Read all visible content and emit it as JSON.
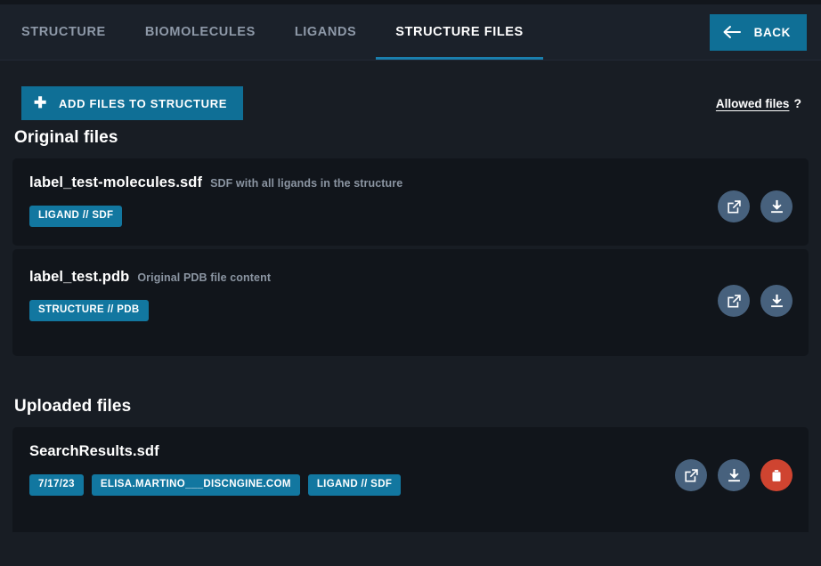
{
  "window": {
    "title": "Structure Files"
  },
  "colors": {
    "accent": "#0f6f96",
    "tag": "#1277a0",
    "tab_underline": "#1a7fad",
    "icon_button": "#47617d",
    "danger": "#cf4430",
    "page_background": "#181d24",
    "card_background": "#11151b",
    "tabbar_background": "#1b212a",
    "muted_text": "#8b95a2"
  },
  "tabbar": {
    "tabs": [
      {
        "label": "STRUCTURE",
        "active": false
      },
      {
        "label": "BIOMOLECULES",
        "active": false
      },
      {
        "label": "LIGANDS",
        "active": false
      },
      {
        "label": "STRUCTURE FILES",
        "active": true
      }
    ],
    "back_button": {
      "label": "BACK",
      "icon": "arrow-left-icon"
    }
  },
  "toolbar": {
    "add_files_label": "ADD FILES TO STRUCTURE",
    "add_files_icon": "plus-icon",
    "allowed_files_label": "Allowed files",
    "allowed_files_hint": "?"
  },
  "sections": [
    {
      "title": "Original files",
      "files": [
        {
          "name": "label_test-molecules.sdf",
          "description": "SDF with all ligands in the structure",
          "tags": [
            "LIGAND // SDF"
          ],
          "actions": [
            "external-link-icon",
            "download-icon"
          ]
        },
        {
          "name": "label_test.pdb",
          "description": "Original PDB file content",
          "tags": [
            "STRUCTURE // PDB"
          ],
          "actions": [
            "external-link-icon",
            "download-icon"
          ]
        }
      ]
    },
    {
      "title": "Uploaded files",
      "files": [
        {
          "name": "SearchResults.sdf",
          "description": "",
          "tags": [
            "7/17/23",
            "ELISA.MARTINO___DISCNGINE.COM",
            "LIGAND // SDF"
          ],
          "actions": [
            "external-link-icon",
            "download-icon",
            "trash-icon"
          ]
        }
      ]
    }
  ]
}
